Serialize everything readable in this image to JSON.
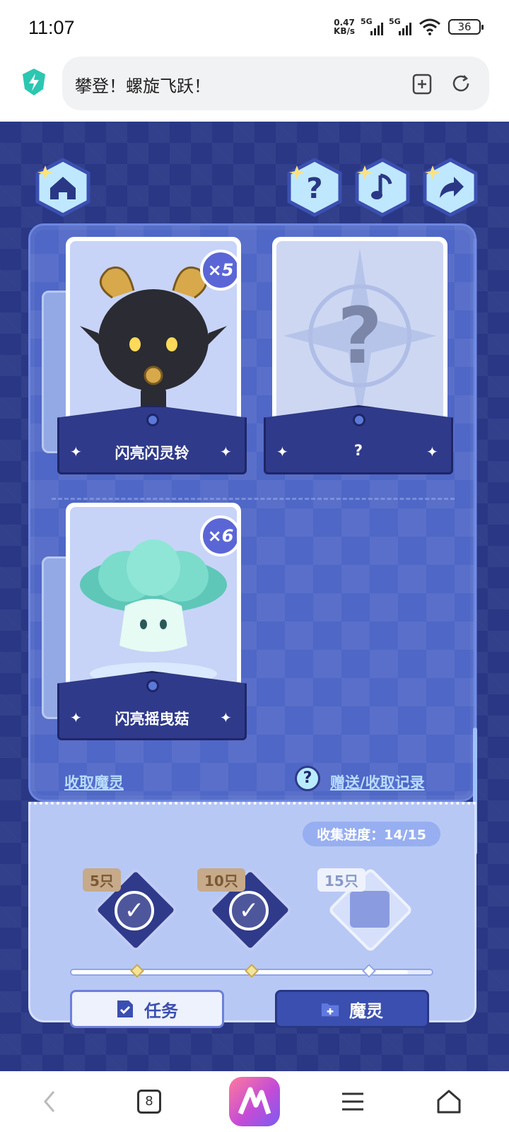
{
  "status_bar": {
    "time": "11:07",
    "net_speed_value": "0.47",
    "net_speed_unit": "KB/s",
    "signal_1_label": "5G",
    "signal_2_label": "5G",
    "battery": "36"
  },
  "browser": {
    "page_title": "攀登！螺旋飞跃！"
  },
  "game": {
    "cards": [
      {
        "name": "闪亮闪灵铃",
        "count": "×5"
      },
      {
        "name": "?",
        "count": ""
      },
      {
        "name": "闪亮摇曳菇",
        "count": "×6"
      }
    ],
    "links": {
      "collect": "收取魔灵",
      "help": "?",
      "records": "赠送/收取记录"
    },
    "progress": {
      "label": "收集进度：",
      "value": "14/15",
      "current": 14,
      "total": 15,
      "milestones": [
        {
          "tag": "5只",
          "claimed": true
        },
        {
          "tag": "10只",
          "claimed": true
        },
        {
          "tag": "15只",
          "claimed": false
        }
      ]
    },
    "buttons": {
      "task": "任务",
      "spirit": "魔灵"
    }
  },
  "bottom_nav": {
    "tabs_count": "8"
  },
  "colors": {
    "background": "#2a3785",
    "panel": "#4f67c6",
    "accent": "#3b4fb0"
  }
}
